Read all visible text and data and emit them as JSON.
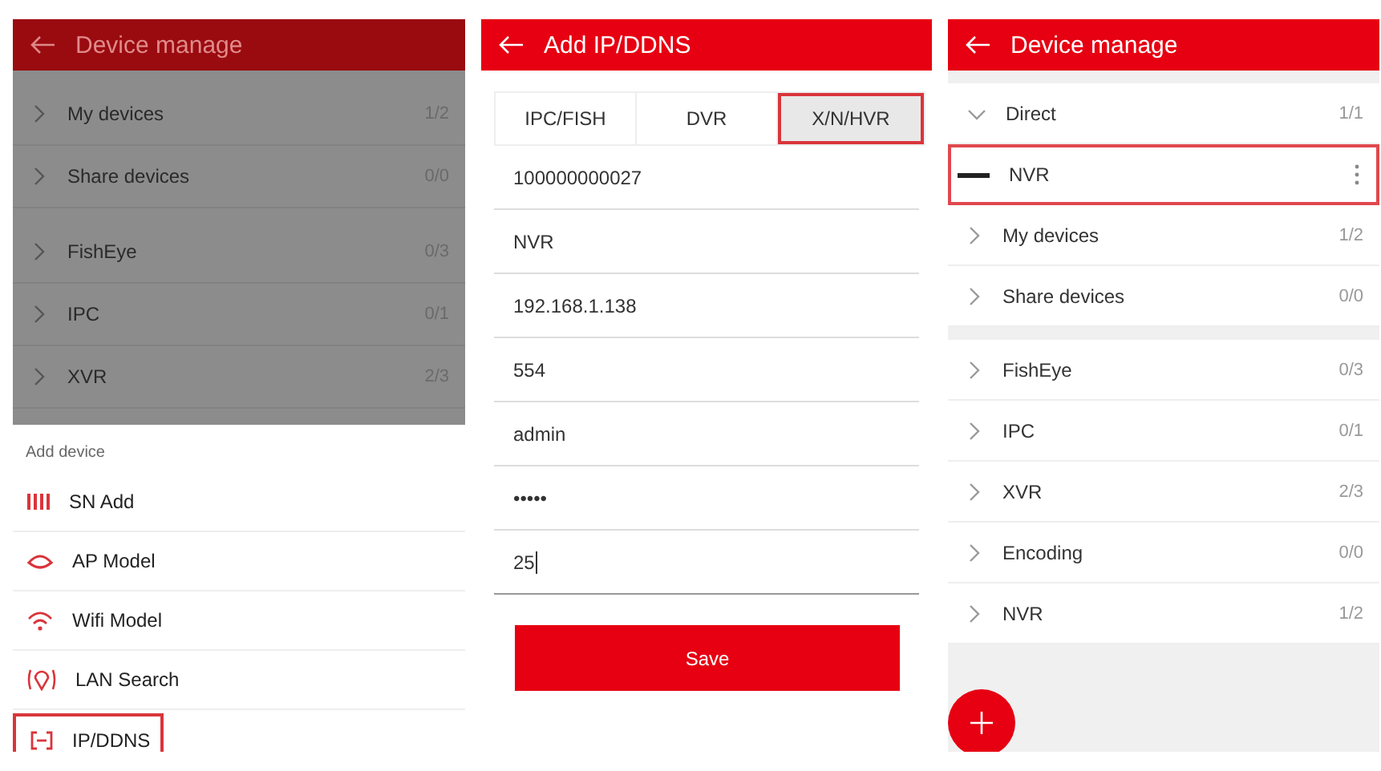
{
  "screens": [
    {
      "kind": "device_list",
      "title": "Device manage",
      "dimmed": true,
      "groups": [
        [
          {
            "label": "My devices",
            "count": "1/2",
            "expanded": false
          },
          {
            "label": "Share devices",
            "count": "0/0",
            "expanded": false
          }
        ],
        [
          {
            "label": "FishEye",
            "count": "0/3",
            "expanded": false
          },
          {
            "label": "IPC",
            "count": "0/1",
            "expanded": false
          },
          {
            "label": "XVR",
            "count": "2/3",
            "expanded": false
          }
        ]
      ],
      "add_sheet": {
        "title": "Add device",
        "items": [
          {
            "label": "SN Add",
            "selected": false
          },
          {
            "label": "AP Model",
            "selected": false
          },
          {
            "label": "Wifi Model",
            "selected": false
          },
          {
            "label": "LAN Search",
            "selected": false
          },
          {
            "label": "IP/DDNS",
            "selected": true
          }
        ]
      }
    },
    {
      "kind": "form",
      "title": "Add IP/DDNS",
      "tabs": [
        {
          "label": "IPC/FISH",
          "selected": false
        },
        {
          "label": "DVR",
          "selected": false
        },
        {
          "label": "X/N/HVR",
          "selected": true
        }
      ],
      "fields": [
        {
          "value": "100000000027",
          "focused": false
        },
        {
          "value": "NVR",
          "focused": false
        },
        {
          "value": "192.168.1.138",
          "focused": false
        },
        {
          "value": "554",
          "focused": false
        },
        {
          "value": "admin",
          "focused": false
        },
        {
          "value": "•••••",
          "focused": false
        },
        {
          "value": "25",
          "focused": true
        }
      ],
      "save_button": "Save"
    },
    {
      "kind": "device_list",
      "title": "Device manage",
      "dimmed": false,
      "groups": [
        [
          {
            "label": "Direct",
            "count": "1/1",
            "expanded": true,
            "children": [
              {
                "label": "NVR",
                "selected": true
              }
            ]
          },
          {
            "label": "My devices",
            "count": "1/2",
            "expanded": false
          },
          {
            "label": "Share devices",
            "count": "0/0",
            "expanded": false
          }
        ],
        [
          {
            "label": "FishEye",
            "count": "0/3",
            "expanded": false
          },
          {
            "label": "IPC",
            "count": "0/1",
            "expanded": false
          },
          {
            "label": "XVR",
            "count": "2/3",
            "expanded": false
          },
          {
            "label": "Encoding",
            "count": "0/0",
            "expanded": false
          },
          {
            "label": "NVR",
            "count": "1/2",
            "expanded": false
          }
        ]
      ],
      "add_button": true
    }
  ]
}
